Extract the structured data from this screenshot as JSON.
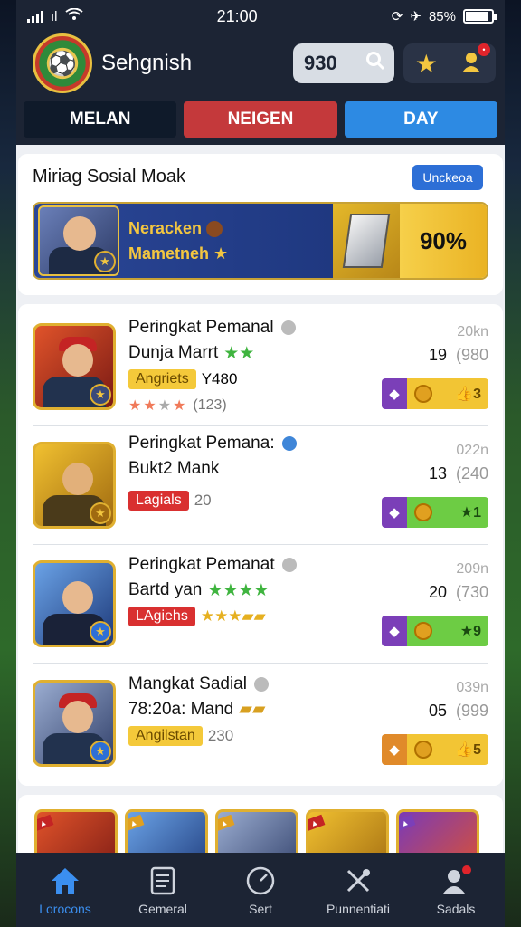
{
  "status": {
    "time": "21:00",
    "battery": "85%",
    "carrier": "ıl"
  },
  "header": {
    "title": "Sehgnish",
    "coins": "930"
  },
  "tabs": [
    {
      "label": "MELAN"
    },
    {
      "label": "NEIGEN"
    },
    {
      "label": "DAY"
    }
  ],
  "featured": {
    "title": "Miriag  Sosial Moak",
    "button": "Unckeoa",
    "name_line1": "Neracken",
    "name_line2": "Mametneh",
    "percent": "90%"
  },
  "rankings": [
    {
      "title": "Peringkat Pemanal",
      "subtitle": "Dunja Marrt",
      "tag": "Angriets",
      "extra": "Y480",
      "count": "(123)",
      "stars": [
        "★",
        "★",
        "★",
        "★"
      ],
      "top_right": "20kn",
      "num": "19",
      "num_muted": "(980",
      "action_value": "3",
      "action_color": "yellow",
      "left_chip": "purple"
    },
    {
      "title": "Peringkat Pemana:",
      "subtitle": "Bukt2 Mank",
      "tag": "Lagials",
      "extra": "20",
      "top_right": "022n",
      "num": "13",
      "num_muted": "(240",
      "action_value": "1",
      "action_color": "green",
      "left_chip": "purple"
    },
    {
      "title": "Peringkat Pemanat",
      "subtitle": "Bartd yan",
      "tag": "LAgiehs",
      "top_right": "209n",
      "num": "20",
      "num_muted": "(730",
      "action_value": "9",
      "action_color": "green",
      "left_chip": "purple"
    },
    {
      "title": "Mangkat Sadial",
      "subtitle": "78:20a: Mand",
      "tag": "Angilstan",
      "extra": "230",
      "top_right": "039n",
      "num": "05",
      "num_muted": "(999",
      "action_value": "5",
      "action_color": "yellow",
      "left_chip": "orange"
    }
  ],
  "nav": [
    {
      "label": "Lorocons"
    },
    {
      "label": "Gemeral"
    },
    {
      "label": "Sert"
    },
    {
      "label": "Punnentiati"
    },
    {
      "label": "Sadals"
    }
  ]
}
